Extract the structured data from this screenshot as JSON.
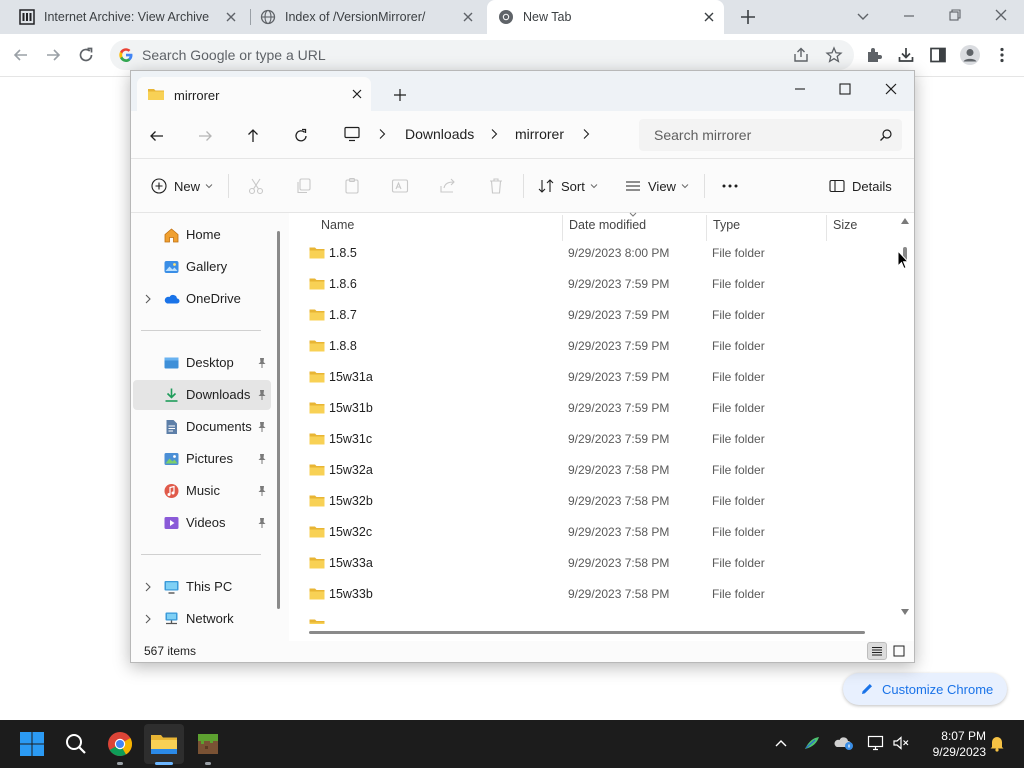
{
  "browser": {
    "tabs": [
      {
        "title": "Internet Archive: View Archive",
        "active": false
      },
      {
        "title": "Index of /VersionMirrorer/",
        "active": false
      },
      {
        "title": "New Tab",
        "active": true
      }
    ],
    "omnibox_placeholder": "Search Google or type a URL",
    "customize_label": "Customize Chrome"
  },
  "explorer": {
    "tab_title": "mirrorer",
    "breadcrumb": [
      "Downloads",
      "mirrorer"
    ],
    "search_placeholder": "Search mirrorer",
    "commands": {
      "new": "New",
      "sort": "Sort",
      "view": "View",
      "details": "Details"
    },
    "nav": {
      "quick": [
        {
          "label": "Home",
          "icon": "home-icon"
        },
        {
          "label": "Gallery",
          "icon": "gallery-icon"
        },
        {
          "label": "OneDrive",
          "icon": "onedrive-icon"
        }
      ],
      "pinned": [
        {
          "label": "Desktop",
          "icon": "desktop-folder-icon"
        },
        {
          "label": "Downloads",
          "icon": "download-icon",
          "selected": true
        },
        {
          "label": "Documents",
          "icon": "documents-icon"
        },
        {
          "label": "Pictures",
          "icon": "pictures-icon"
        },
        {
          "label": "Music",
          "icon": "music-icon"
        },
        {
          "label": "Videos",
          "icon": "videos-icon"
        }
      ],
      "devices": [
        {
          "label": "This PC",
          "icon": "computer-icon"
        },
        {
          "label": "Network",
          "icon": "network-icon"
        }
      ]
    },
    "columns": {
      "name": "Name",
      "date": "Date modified",
      "type": "Type",
      "size": "Size"
    },
    "files": [
      {
        "name": "1.8.5",
        "date": "9/29/2023 8:00 PM",
        "type": "File folder"
      },
      {
        "name": "1.8.6",
        "date": "9/29/2023 7:59 PM",
        "type": "File folder"
      },
      {
        "name": "1.8.7",
        "date": "9/29/2023 7:59 PM",
        "type": "File folder"
      },
      {
        "name": "1.8.8",
        "date": "9/29/2023 7:59 PM",
        "type": "File folder"
      },
      {
        "name": "15w31a",
        "date": "9/29/2023 7:59 PM",
        "type": "File folder"
      },
      {
        "name": "15w31b",
        "date": "9/29/2023 7:59 PM",
        "type": "File folder"
      },
      {
        "name": "15w31c",
        "date": "9/29/2023 7:59 PM",
        "type": "File folder"
      },
      {
        "name": "15w32a",
        "date": "9/29/2023 7:58 PM",
        "type": "File folder"
      },
      {
        "name": "15w32b",
        "date": "9/29/2023 7:58 PM",
        "type": "File folder"
      },
      {
        "name": "15w32c",
        "date": "9/29/2023 7:58 PM",
        "type": "File folder"
      },
      {
        "name": "15w33a",
        "date": "9/29/2023 7:58 PM",
        "type": "File folder"
      },
      {
        "name": "15w33b",
        "date": "9/29/2023 7:58 PM",
        "type": "File folder"
      }
    ],
    "item_count": "567 items"
  },
  "taskbar": {
    "time": "8:07 PM",
    "date": "9/29/2023"
  }
}
